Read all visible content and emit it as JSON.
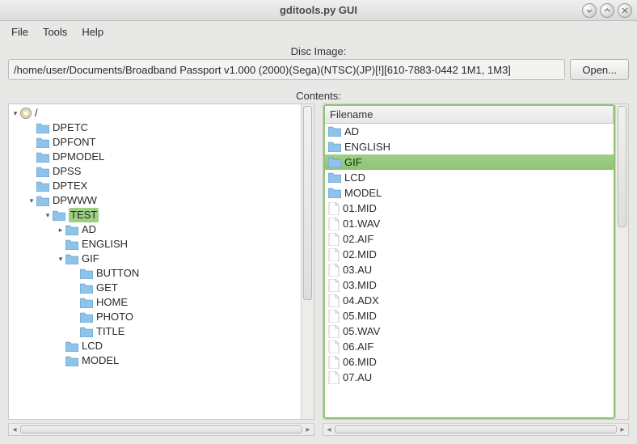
{
  "window": {
    "title": "gditools.py GUI"
  },
  "menubar": {
    "items": [
      "File",
      "Tools",
      "Help"
    ]
  },
  "disc": {
    "label": "Disc Image:",
    "path": "/home/user/Documents/Broadband Passport v1.000 (2000)(Sega)(NTSC)(JP)[!][610-7883-0442 1M1, 1M3]",
    "open_label": "Open..."
  },
  "contents": {
    "label": "Contents:",
    "filename_header": "Filename"
  },
  "tree": [
    {
      "depth": 0,
      "expander": "v",
      "icon": "cd",
      "label": "/",
      "selected": false
    },
    {
      "depth": 1,
      "expander": "",
      "icon": "folder",
      "label": "DPETC",
      "selected": false
    },
    {
      "depth": 1,
      "expander": "",
      "icon": "folder",
      "label": "DPFONT",
      "selected": false
    },
    {
      "depth": 1,
      "expander": "",
      "icon": "folder",
      "label": "DPMODEL",
      "selected": false
    },
    {
      "depth": 1,
      "expander": "",
      "icon": "folder",
      "label": "DPSS",
      "selected": false
    },
    {
      "depth": 1,
      "expander": "",
      "icon": "folder",
      "label": "DPTEX",
      "selected": false
    },
    {
      "depth": 1,
      "expander": "v",
      "icon": "folder",
      "label": "DPWWW",
      "selected": false
    },
    {
      "depth": 2,
      "expander": "v",
      "icon": "folder",
      "label": "TEST",
      "selected": true
    },
    {
      "depth": 3,
      "expander": ">",
      "icon": "folder",
      "label": "AD",
      "selected": false
    },
    {
      "depth": 3,
      "expander": "",
      "icon": "folder",
      "label": "ENGLISH",
      "selected": false
    },
    {
      "depth": 3,
      "expander": "v",
      "icon": "folder",
      "label": "GIF",
      "selected": false
    },
    {
      "depth": 4,
      "expander": "",
      "icon": "folder",
      "label": "BUTTON",
      "selected": false
    },
    {
      "depth": 4,
      "expander": "",
      "icon": "folder",
      "label": "GET",
      "selected": false
    },
    {
      "depth": 4,
      "expander": "",
      "icon": "folder",
      "label": "HOME",
      "selected": false
    },
    {
      "depth": 4,
      "expander": "",
      "icon": "folder",
      "label": "PHOTO",
      "selected": false
    },
    {
      "depth": 4,
      "expander": "",
      "icon": "folder",
      "label": "TITLE",
      "selected": false
    },
    {
      "depth": 3,
      "expander": "",
      "icon": "folder",
      "label": "LCD",
      "selected": false
    },
    {
      "depth": 3,
      "expander": "",
      "icon": "folder",
      "label": "MODEL",
      "selected": false
    }
  ],
  "filelist": [
    {
      "icon": "folder",
      "label": "AD",
      "selected": false
    },
    {
      "icon": "folder",
      "label": "ENGLISH",
      "selected": false
    },
    {
      "icon": "folder",
      "label": "GIF",
      "selected": true
    },
    {
      "icon": "folder",
      "label": "LCD",
      "selected": false
    },
    {
      "icon": "folder",
      "label": "MODEL",
      "selected": false
    },
    {
      "icon": "file",
      "label": "01.MID",
      "selected": false
    },
    {
      "icon": "file",
      "label": "01.WAV",
      "selected": false
    },
    {
      "icon": "file",
      "label": "02.AIF",
      "selected": false
    },
    {
      "icon": "file",
      "label": "02.MID",
      "selected": false
    },
    {
      "icon": "file",
      "label": "03.AU",
      "selected": false
    },
    {
      "icon": "file",
      "label": "03.MID",
      "selected": false
    },
    {
      "icon": "file",
      "label": "04.ADX",
      "selected": false
    },
    {
      "icon": "file",
      "label": "05.MID",
      "selected": false
    },
    {
      "icon": "file",
      "label": "05.WAV",
      "selected": false
    },
    {
      "icon": "file",
      "label": "06.AIF",
      "selected": false
    },
    {
      "icon": "file",
      "label": "06.MID",
      "selected": false
    },
    {
      "icon": "file",
      "label": "07.AU",
      "selected": false
    }
  ]
}
